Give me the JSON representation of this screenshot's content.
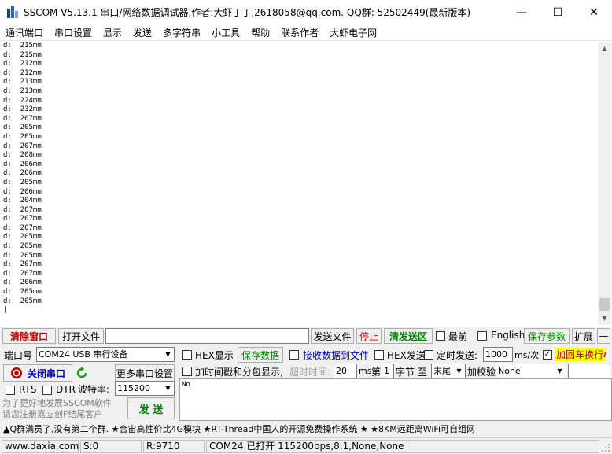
{
  "window": {
    "title": "SSCOM V5.13.1 串口/网络数据调试器,作者:大虾丁丁,2618058@qq.com. QQ群: 52502449(最新版本)",
    "minimize": "—",
    "maximize": "☐",
    "close": "✕"
  },
  "menu": [
    "通讯端口",
    "串口设置",
    "显示",
    "发送",
    "多字符串",
    "小工具",
    "帮助",
    "联系作者",
    "大虾电子网"
  ],
  "receive_lines": [
    "d:  215mm",
    "d:  215mm",
    "d:  212mm",
    "d:  212mm",
    "d:  213mm",
    "d:  213mm",
    "d:  224mm",
    "d:  232mm",
    "d:  207mm",
    "d:  205mm",
    "d:  205mm",
    "d:  207mm",
    "d:  208mm",
    "d:  206mm",
    "d:  206mm",
    "d:  205mm",
    "d:  206mm",
    "d:  204mm",
    "d:  207mm",
    "d:  207mm",
    "d:  207mm",
    "d:  205mm",
    "d:  205mm",
    "d:  205mm",
    "d:  207mm",
    "d:  207mm",
    "d:  206mm",
    "d:  205mm",
    "d:  205mm"
  ],
  "toolbar": {
    "clear_window": "清除窗口",
    "open_file": "打开文件",
    "file_path": "",
    "send_file": "发送文件",
    "stop": "停止",
    "clear_send": "清发送区",
    "topmost": "最前",
    "english": "English",
    "save_params": "保存参数",
    "expand": "扩展",
    "collapse": "—"
  },
  "port": {
    "port_label": "端口号",
    "port_value": "COM24 USB 串行设备",
    "close_port": "关闭串口",
    "more_settings": "更多串口设置",
    "rts": "RTS",
    "dtr": "DTR",
    "baud_label": "波特率:",
    "baud_value": "115200"
  },
  "options": {
    "hex_display": "HEX显示",
    "save_data": "保存数据",
    "recv_to_file": "接收数据到文件",
    "hex_send": "HEX发送",
    "timed_send": "定时发送:",
    "interval": "1000",
    "interval_unit": "ms/次",
    "append_newline": "加回车换行",
    "help_q": "?",
    "timestamp": "加时间戳和分包显示,",
    "timeout_label": "超时时间:",
    "timeout_value": "20",
    "timeout_unit": "ms",
    "byte_prefix": "第",
    "byte_from": "1",
    "byte_to_label": "字节 至",
    "byte_end": "末尾",
    "checksum_label": "加校验",
    "checksum_value": "None"
  },
  "send": {
    "text": "No",
    "button": "发 送",
    "promo": "为了更好地发展SSCOM软件\n请您注册嘉立创F结尾客户"
  },
  "marquee": "▲Q群满员了,没有第二个群. ★合宙高性价比4G模块 ★RT-Thread中国人的开源免费操作系统 ★ ★8KM远距离WiFi可自组网",
  "status": {
    "site": "www.daxia.com",
    "sent": "S:0",
    "received": "R:9710",
    "port_state": "COM24 已打开  115200bps,8,1,None,None"
  },
  "colors": {
    "accent_red": "#c00000",
    "accent_green": "#008000",
    "highlight_yellow": "#ffff00"
  }
}
